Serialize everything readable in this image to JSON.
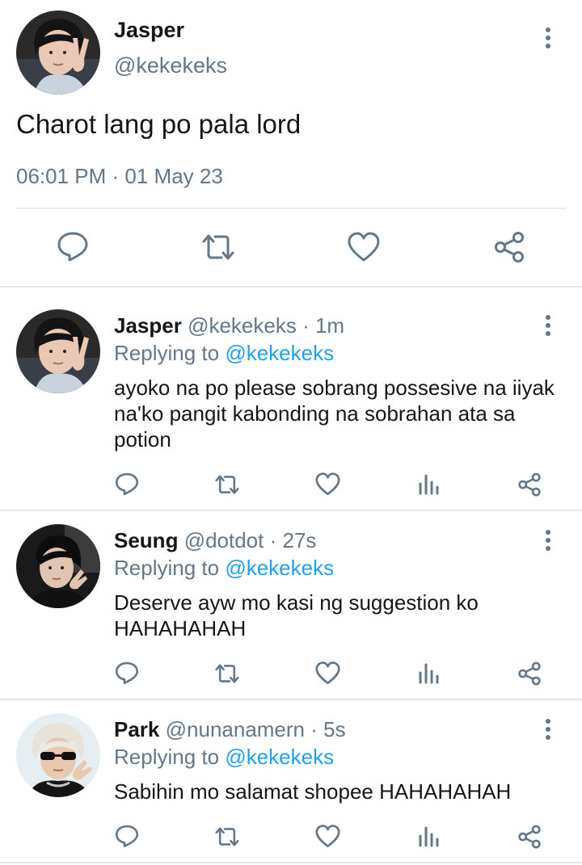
{
  "main_tweet": {
    "name": "Jasper",
    "handle": "@kekekeks",
    "text": "Charot lang po pala lord",
    "timestamp": "06:01 PM · 01 May 23",
    "actions": [
      "reply-icon",
      "retweet-icon",
      "like-icon",
      "share-icon"
    ]
  },
  "replies": [
    {
      "name": "Jasper",
      "handle": "@kekekeks",
      "sep": " · ",
      "time": "1m",
      "replying_prefix": "Replying to ",
      "replying_to": "@kekekeks",
      "text": "ayoko na po please sobrang possesive na iiyak na'ko pangit kabonding na sobrahan ata sa potion"
    },
    {
      "name": "Seung",
      "handle": "@dotdot",
      "sep": " · ",
      "time": "27s",
      "replying_prefix": "Replying to ",
      "replying_to": "@kekekeks",
      "text": "Deserve ayw mo kasi ng suggestion ko HAHAHAHAH"
    },
    {
      "name": "Park",
      "handle": "@nunanamern",
      "sep": " · ",
      "time": "5s",
      "replying_prefix": "Replying to ",
      "replying_to": "@kekekeks",
      "text": "Sabihin mo salamat shopee HAHAHAHAH"
    }
  ],
  "reply_actions": [
    "reply-icon",
    "retweet-icon",
    "like-icon",
    "analytics-icon",
    "share-icon"
  ],
  "colors": {
    "text": "#14171a",
    "secondary": "#657786",
    "link": "#1da1f2",
    "divider": "#e1e8ed"
  }
}
